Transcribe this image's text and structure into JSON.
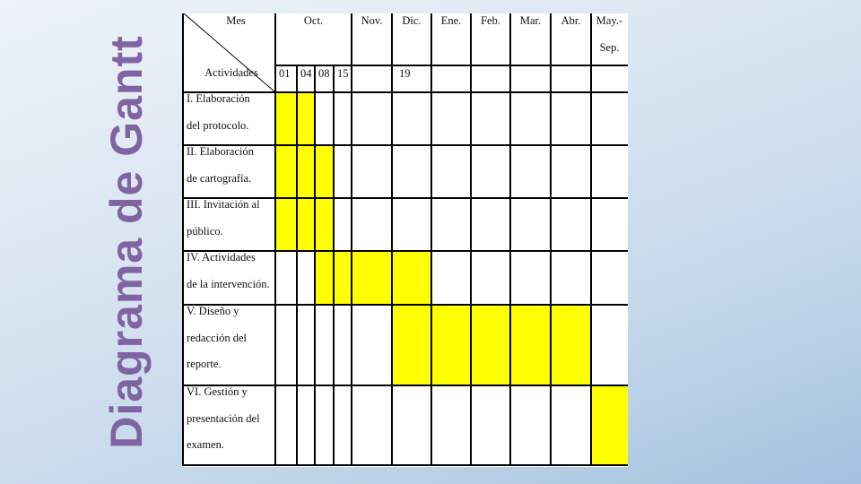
{
  "slide": {
    "title": "Diagrama de Gantt",
    "title_color": "#8064a2"
  },
  "chart_data": {
    "type": "table",
    "title": "Diagrama de Gantt",
    "header": {
      "corner_top": "Mes",
      "corner_bottom": "Actividades"
    },
    "months": [
      {
        "label": "Oct.",
        "sub": [
          "01",
          "04",
          "08",
          "15"
        ]
      },
      {
        "label": "Nov.",
        "sub": [
          ""
        ]
      },
      {
        "label": "Dic.",
        "sub": [
          "19"
        ]
      },
      {
        "label": "Ene.",
        "sub": [
          ""
        ]
      },
      {
        "label": "Feb.",
        "sub": [
          ""
        ]
      },
      {
        "label": "Mar.",
        "sub": [
          ""
        ]
      },
      {
        "label": "Abr.",
        "sub": [
          ""
        ]
      },
      {
        "label": "May.- Sep.",
        "label_lines": [
          "May.-",
          "Sep."
        ],
        "sub": [
          ""
        ]
      }
    ],
    "columns": [
      "Oct. 01",
      "Oct. 04",
      "Oct. 08",
      "Oct. 15",
      "Nov.",
      "Dic. 19",
      "Ene.",
      "Feb.",
      "Mar.",
      "Abr.",
      "May.-Sep."
    ],
    "activities": [
      {
        "label": "I. Elaboración del protocolo.",
        "lines": [
          "I. Elaboración",
          "del protocolo."
        ],
        "active": [
          1,
          1,
          0,
          0,
          0,
          0,
          0,
          0,
          0,
          0,
          0
        ]
      },
      {
        "label": "II. Elaboración de cartografía.",
        "lines": [
          "II. Elaboración",
          "de cartografía."
        ],
        "active": [
          1,
          1,
          1,
          0,
          0,
          0,
          0,
          0,
          0,
          0,
          0
        ]
      },
      {
        "label": "III. Invitación al público.",
        "lines": [
          "III. Invitación al",
          "público."
        ],
        "active": [
          1,
          1,
          1,
          0,
          0,
          0,
          0,
          0,
          0,
          0,
          0
        ]
      },
      {
        "label": "IV. Actividades de la intervención.",
        "lines": [
          "IV. Actividades",
          "de la intervención."
        ],
        "active": [
          0,
          0,
          1,
          1,
          1,
          1,
          0,
          0,
          0,
          0,
          0
        ]
      },
      {
        "label": "V. Diseño y redacción del reporte.",
        "lines": [
          "V. Diseño y",
          "redacción del",
          "reporte."
        ],
        "active": [
          0,
          0,
          0,
          0,
          0,
          1,
          1,
          1,
          1,
          1,
          0
        ]
      },
      {
        "label": "VI. Gestión y presentación del examen.",
        "lines": [
          "VI. Gestión y",
          "presentación del",
          "examen."
        ],
        "active": [
          0,
          0,
          0,
          0,
          0,
          0,
          0,
          0,
          0,
          0,
          1
        ]
      }
    ],
    "fill_color": "#ffff00",
    "line_color": "#000000"
  }
}
